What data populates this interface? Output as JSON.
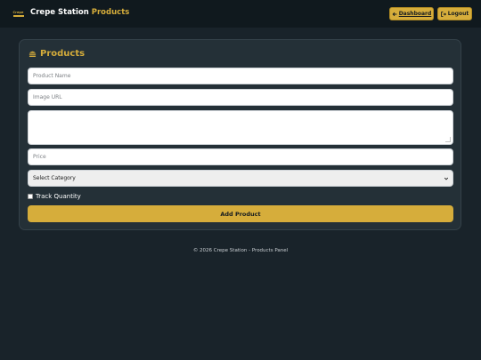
{
  "header": {
    "logo_text": "Crepe Station",
    "brand_main": "Crepe Station",
    "brand_accent": "Products",
    "dashboard_label": "Dashboard",
    "logout_label": "Logout"
  },
  "card": {
    "title": "Products",
    "product_name_placeholder": "Product Name",
    "image_url_placeholder": "Image URL",
    "description_value": "",
    "price_placeholder": "Price",
    "category_selected": "Select Category",
    "track_quantity_label": "Track Quantity",
    "track_quantity_checked": false,
    "add_button_label": "Add Product"
  },
  "footer": {
    "text": "© 2026 Crepe Station - Products Panel"
  },
  "colors": {
    "background": "#19232a",
    "topbar": "#10191e",
    "card": "#243037",
    "accent": "#d6ad3b"
  },
  "icons": {
    "dashboard": "arrow-left-icon",
    "logout": "sign-out-icon",
    "title": "hamburger-icon",
    "select": "chevron-down-icon"
  }
}
